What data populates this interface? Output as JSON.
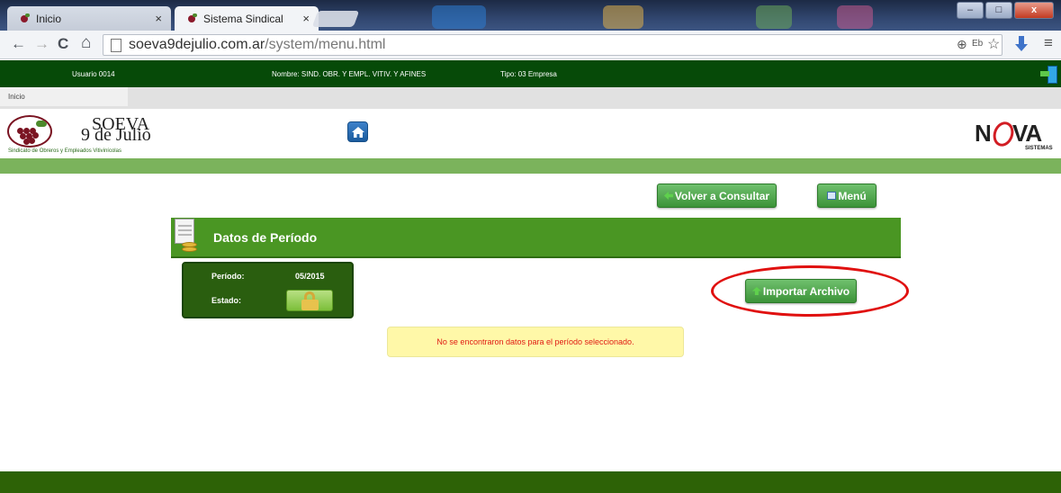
{
  "browser": {
    "tabs": [
      {
        "title": "Inicio",
        "close": "×"
      },
      {
        "title": "Sistema Sindical",
        "close": "×"
      }
    ],
    "url_domain": "soeva9dejulio.com.ar",
    "url_path": "/system/menu.html",
    "nav": {
      "back": "←",
      "forward": "→",
      "reload": "C",
      "home": "⌂"
    },
    "window_buttons": {
      "minimize": "–",
      "maximize": "□",
      "close": "x"
    },
    "toolbar_icons": {
      "zoom": "⊕",
      "translate": "Eb",
      "star": "☆",
      "menu": "≡"
    }
  },
  "userbar": {
    "usuario": "Usuario 0014",
    "nombre": "Nombre: SIND. OBR. Y EMPL. VITIV. Y AFINES",
    "tipo": "Tipo: 03 Empresa"
  },
  "breadcrumb": "Inicio",
  "header": {
    "org_name_line1": "SOEVA",
    "org_name_line2": "9 de Julio",
    "org_tagline": "Sindicato de Obreros y Empleados Vitivinícolas",
    "partner_logo_left": "N",
    "partner_logo_right": "VA",
    "partner_logo_sub": "SISTEMAS"
  },
  "actions": {
    "volver_label": "Volver a Consultar",
    "menu_label": "Menú",
    "importar_label": "Importar Archivo"
  },
  "panel": {
    "title": "Datos de Período",
    "periodo_label": "Período:",
    "periodo_value": "05/2015",
    "estado_label": "Estado:"
  },
  "notice": "No se encontraron datos para el período seleccionado.",
  "colors": {
    "dark_green": "#064a08",
    "panel_green": "#4a9623",
    "strip_green": "#7bb35c",
    "notice_bg": "#fff8a8",
    "notice_text": "#e01a12",
    "annotation_red": "#e0100f"
  },
  "icons": {
    "home": "home-icon",
    "logout": "logout-icon",
    "back_arrow": "arrow-left-icon",
    "menu": "menu-icon",
    "upload": "arrow-up-icon",
    "lock": "lock-icon",
    "document": "document-coins-icon"
  }
}
